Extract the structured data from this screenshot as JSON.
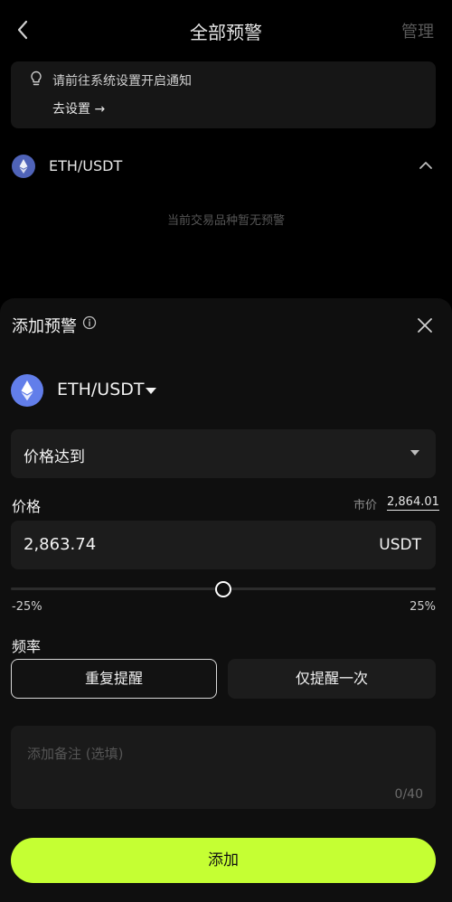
{
  "header": {
    "title": "全部预警",
    "manage_label": "管理"
  },
  "notice": {
    "text": "请前往系统设置开启通知",
    "link_label": "去设置 →"
  },
  "pair_row": {
    "label": "ETH/USDT",
    "empty_text": "当前交易品种暂无预警"
  },
  "sheet": {
    "title": "添加预警",
    "pair_label": "ETH/USDT",
    "condition": {
      "selected": "价格达到"
    },
    "price": {
      "label": "价格",
      "market_label": "市价",
      "market_value": "2,864.01",
      "value": "2,863.74",
      "unit": "USDT"
    },
    "slider": {
      "min_label": "-25%",
      "max_label": "25%",
      "value_percent": 0,
      "range_percent": [
        -25,
        25
      ]
    },
    "frequency": {
      "label": "频率",
      "options": [
        "重复提醒",
        "仅提醒一次"
      ],
      "selected": "重复提醒"
    },
    "note": {
      "placeholder": "添加备注 (选填)",
      "value": "",
      "counter": "0/40"
    },
    "submit_label": "添加"
  },
  "colors": {
    "accent": "#c5ff33",
    "eth": "#627eea",
    "background": "#000000",
    "sheet": "#0f0f0f"
  },
  "icons": {
    "back": "chevron-left-icon",
    "bulb": "lightbulb-icon",
    "eth": "ethereum-icon",
    "collapse": "chevron-up-icon",
    "info": "info-icon",
    "close": "close-icon",
    "caret": "caret-down-icon"
  }
}
